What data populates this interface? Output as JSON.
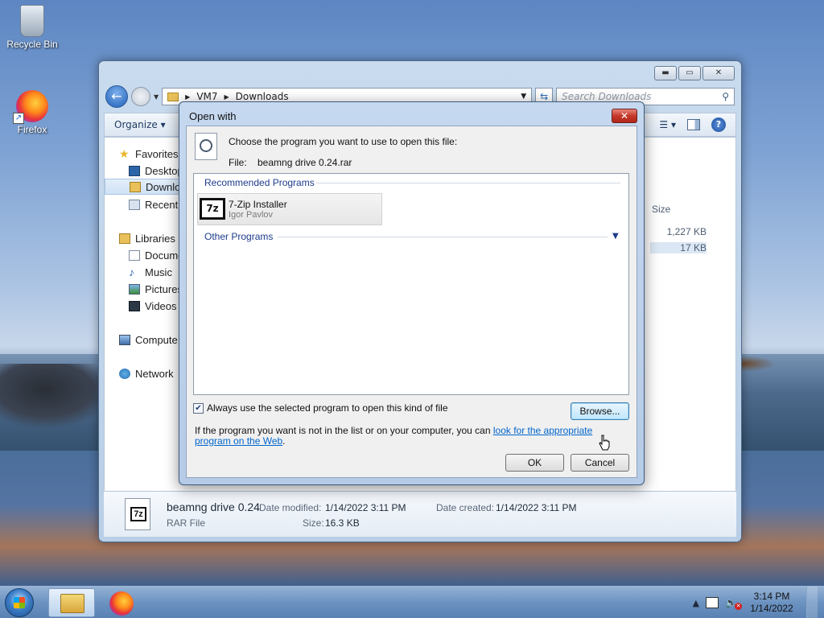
{
  "desktop": {
    "icons": [
      {
        "label": "Recycle Bin",
        "icon": "recycle-bin-icon"
      },
      {
        "label": "Firefox",
        "icon": "firefox-icon"
      }
    ]
  },
  "explorer": {
    "address": [
      "VM7",
      "Downloads"
    ],
    "search_placeholder": "Search Downloads",
    "toolbar": {
      "organize": "Organize"
    },
    "nav_pane": {
      "favorites": "Favorites",
      "desktop": "Desktop",
      "downloads": "Downlo",
      "recent": "Recent P",
      "libraries": "Libraries",
      "documents": "Docume",
      "music": "Music",
      "pictures": "Pictures",
      "videos": "Videos",
      "computer": "Compute",
      "network": "Network"
    },
    "columns": {
      "size": "Size"
    },
    "size_values": [
      "1,227 KB",
      "17 KB"
    ],
    "details_pane": {
      "file_name": "beamng drive 0.24",
      "file_type": "RAR File",
      "modified_label": "Date modified:",
      "modified_value": "1/14/2022 3:11 PM",
      "created_label": "Date created:",
      "created_value": "1/14/2022 3:11 PM",
      "size_label": "Size:",
      "size_value": "16.3 KB"
    }
  },
  "dialog": {
    "title": "Open with",
    "prompt": "Choose the program you want to use to open this file:",
    "file_label": "File:",
    "file_name": "beamng drive 0.24.rar",
    "recommended_header": "Recommended Programs",
    "other_header": "Other Programs",
    "programs": [
      {
        "name": "7-Zip Installer",
        "publisher": "Igor Pavlov"
      }
    ],
    "always_use_label": "Always use the selected program to open this kind of file",
    "always_use_checked": true,
    "browse_label": "Browse...",
    "info_text": "If the program you want is not in the list or on your computer, you can ",
    "info_link": "look for the appropriate program on the Web",
    "info_tail": ".",
    "ok_label": "OK",
    "cancel_label": "Cancel"
  },
  "taskbar": {
    "clock_time": "3:14 PM",
    "clock_date": "1/14/2022"
  }
}
